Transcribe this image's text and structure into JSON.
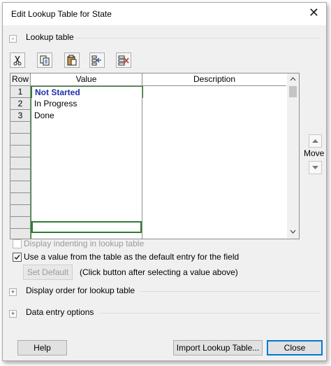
{
  "window": {
    "title": "Edit Lookup Table for State",
    "close_glyph": "✕"
  },
  "lookup_section": {
    "label": "Lookup table",
    "toggle": "-"
  },
  "toolbar": {
    "icons": [
      "cut-icon",
      "copy-icon",
      "paste-icon",
      "insert-row-icon",
      "delete-row-icon"
    ]
  },
  "grid": {
    "headers": {
      "row": "Row",
      "value": "Value",
      "description": "Description"
    },
    "rows": [
      {
        "num": "1",
        "value": "Not Started",
        "description": ""
      },
      {
        "num": "2",
        "value": "In Progress",
        "description": ""
      },
      {
        "num": "3",
        "value": "Done",
        "description": ""
      }
    ]
  },
  "move": {
    "label": "Move"
  },
  "options": {
    "indent_label": "Display indenting in lookup table",
    "default_label": "Use a value from the table as the default entry for the field",
    "set_default_label": "Set Default",
    "set_default_hint": "(Click button after selecting a value above)"
  },
  "sections": {
    "display_order": {
      "label": "Display order for lookup table",
      "toggle": "+"
    },
    "data_entry": {
      "label": "Data entry options",
      "toggle": "+"
    }
  },
  "footer": {
    "help_label": "Help",
    "import_label": "Import Lookup Table...",
    "close_label": "Close"
  },
  "colors": {
    "first_value": "#1f2fa8",
    "grid_border": "#8e8e8e",
    "selection_border": "#2e7d32"
  }
}
